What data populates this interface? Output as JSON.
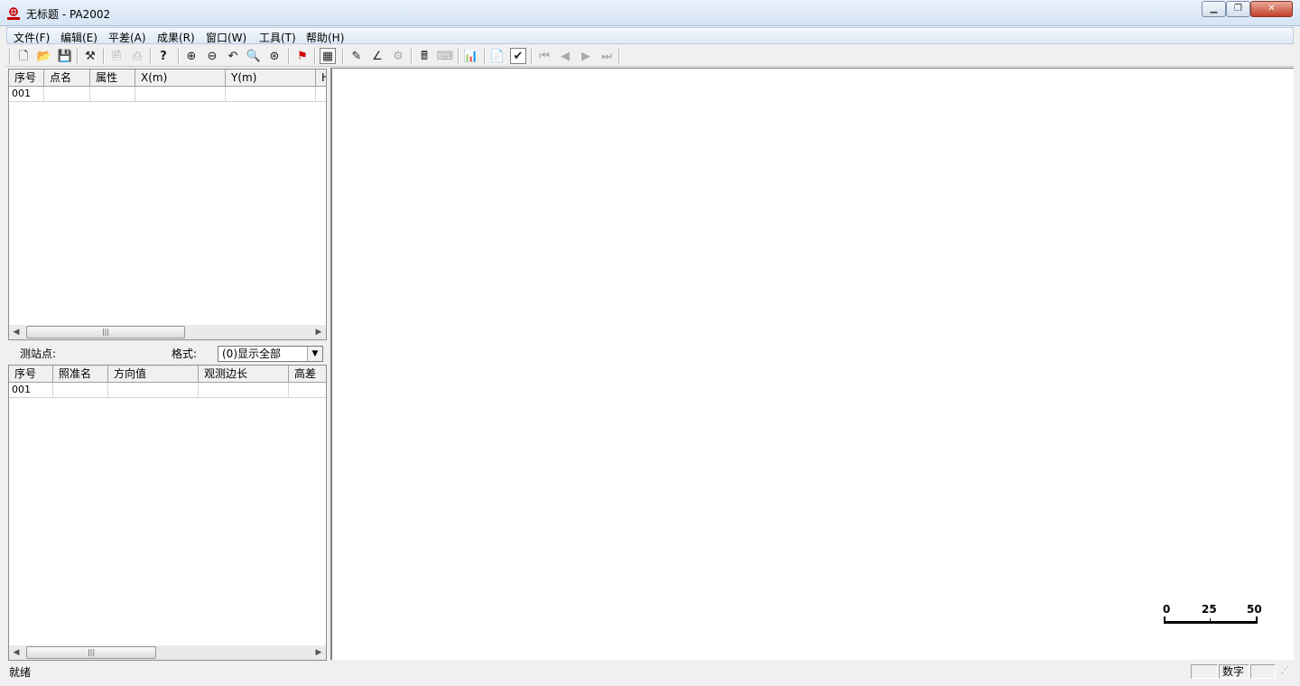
{
  "window": {
    "title": "无标题 - PA2002",
    "app_icon": "sdbm-logo-icon"
  },
  "window_controls": {
    "minimize": "minimize-icon",
    "maximize": "maximize-icon",
    "close": "close-icon"
  },
  "menu": [
    {
      "label": "文件(F)"
    },
    {
      "label": "编辑(E)"
    },
    {
      "label": "平差(A)"
    },
    {
      "label": "成果(R)"
    },
    {
      "label": "窗口(W)"
    },
    {
      "label": "工具(T)"
    },
    {
      "label": "帮助(H)"
    }
  ],
  "toolbar": {
    "buttons": [
      {
        "icon": "new-file-icon",
        "glyph": "🗋"
      },
      {
        "icon": "open-folder-icon",
        "glyph": "📂"
      },
      {
        "icon": "save-icon",
        "glyph": "💾"
      },
      {
        "icon": "network-draw-icon",
        "glyph": "⚒"
      },
      {
        "icon": "print-preview-icon",
        "glyph": "🗎"
      },
      {
        "icon": "print-icon",
        "glyph": "⎙"
      },
      {
        "icon": "help-icon",
        "glyph": "?"
      },
      {
        "icon": "zoom-in-icon",
        "glyph": "⊕"
      },
      {
        "icon": "zoom-out-icon",
        "glyph": "⊖"
      },
      {
        "icon": "zoom-previous-icon",
        "glyph": "↶"
      },
      {
        "icon": "zoom-window-icon",
        "glyph": "🔍"
      },
      {
        "icon": "zoom-all-icon",
        "glyph": "⊛"
      },
      {
        "icon": "flag-icon",
        "glyph": "⚑"
      },
      {
        "icon": "table-view-icon",
        "glyph": "▦"
      },
      {
        "icon": "edit-network-icon",
        "glyph": "✎"
      },
      {
        "icon": "angle-icon",
        "glyph": "∠"
      },
      {
        "icon": "properties-icon",
        "glyph": "⚙"
      },
      {
        "icon": "calc-icon",
        "glyph": "🖩"
      },
      {
        "icon": "keyboard-icon",
        "glyph": "⌨"
      },
      {
        "icon": "bar-chart-icon",
        "glyph": "📊"
      },
      {
        "icon": "report-icon",
        "glyph": "📄"
      },
      {
        "icon": "check-icon",
        "glyph": "✔"
      },
      {
        "icon": "first-record-icon",
        "glyph": "⏮"
      },
      {
        "icon": "previous-record-icon",
        "glyph": "◀"
      },
      {
        "icon": "next-record-icon",
        "glyph": "▶"
      },
      {
        "icon": "last-record-icon",
        "glyph": "⏭"
      }
    ]
  },
  "points_table": {
    "headers": [
      "序号",
      "点名",
      "属性",
      "X(m)",
      "Y(m)",
      "H"
    ],
    "rows": [
      [
        "001",
        "",
        "",
        "",
        "",
        ""
      ]
    ]
  },
  "observation_panel": {
    "station_label": "测站点:",
    "format_label": "格式:",
    "format_value": "(0)显示全部",
    "headers": [
      "序号",
      "照准名",
      "方向值",
      "观测边长",
      "高差"
    ],
    "rows": [
      [
        "001",
        "",
        "",
        "",
        ""
      ]
    ]
  },
  "scale_bar": {
    "labels": [
      "0",
      "25",
      "50"
    ]
  },
  "statusbar": {
    "ready": "就绪",
    "num_lock": "数字"
  }
}
